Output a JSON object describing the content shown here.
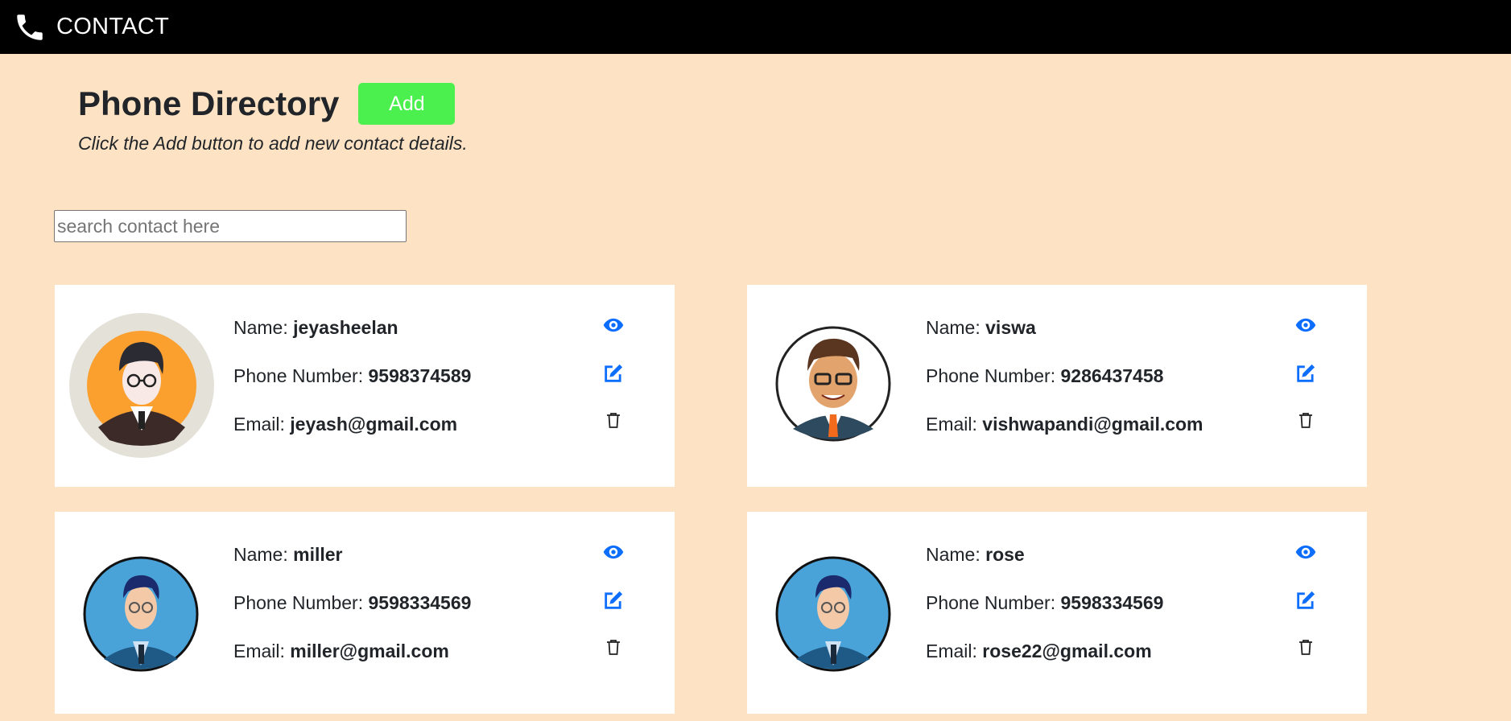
{
  "navbar": {
    "brand": "CONTACT",
    "icon": "phone-icon"
  },
  "header": {
    "title": "Phone Directory",
    "add_label": "Add",
    "subtitle": "Click the Add button to add new contact details."
  },
  "search": {
    "placeholder": "search contact here",
    "value": ""
  },
  "labels": {
    "name": "Name: ",
    "phone": "Phone Number: ",
    "email": "Email: "
  },
  "colors": {
    "accent": "#0d6efd",
    "add": "#4cf04e",
    "background": "#fde3c4"
  },
  "contacts": [
    {
      "name": "jeyasheelan",
      "phone": "9598374589",
      "email": "jeyash@gmail.com",
      "avatar": "orange-avatar"
    },
    {
      "name": "viswa",
      "phone": "9286437458",
      "email": "vishwapandi@gmail.com",
      "avatar": "smiling-avatar"
    },
    {
      "name": "miller",
      "phone": "9598334569",
      "email": "miller@gmail.com",
      "avatar": "blue-avatar"
    },
    {
      "name": "rose",
      "phone": "9598334569",
      "email": "rose22@gmail.com",
      "avatar": "blue-avatar"
    }
  ]
}
